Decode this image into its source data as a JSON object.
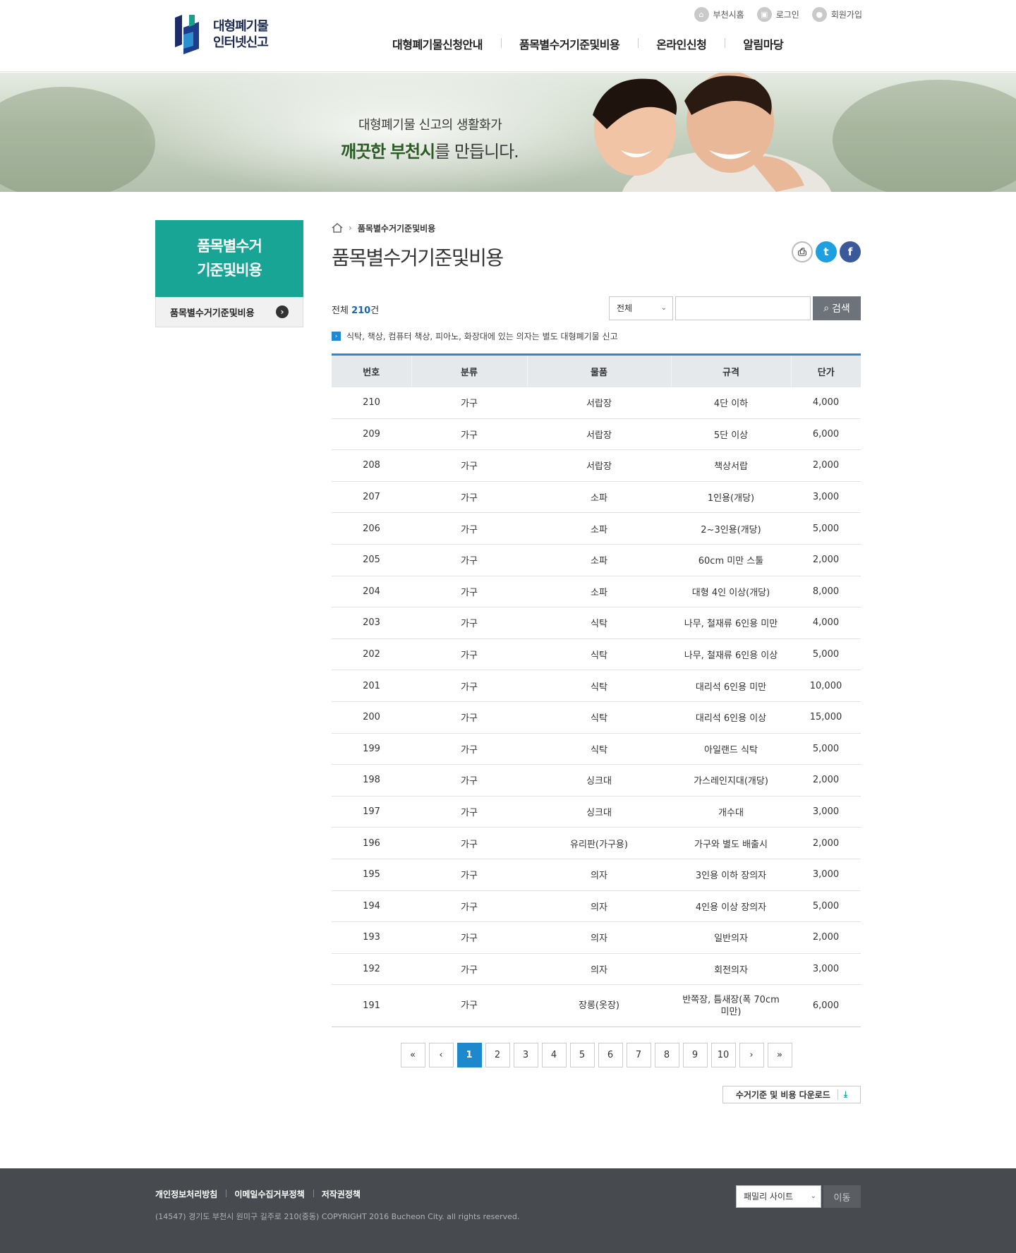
{
  "site": {
    "logo_line1": "대형폐기물",
    "logo_line2": "인터넷신고"
  },
  "util": [
    {
      "label": "부천시홈",
      "icon": "home-icon"
    },
    {
      "label": "로그인",
      "icon": "lock-icon"
    },
    {
      "label": "회원가입",
      "icon": "user-icon"
    }
  ],
  "gnb": [
    "대형폐기물신청안내",
    "품목별수거기준및비용",
    "온라인신청",
    "알림마당"
  ],
  "banner": {
    "line1": "대형폐기물 신고의 생활화가",
    "line2_bold1": "깨끗한",
    "line2_bold2": "부천시",
    "line2_rest": "를 만듭니다."
  },
  "lnb": {
    "title_line1": "품목별수거",
    "title_line2": "기준및비용",
    "item": "품목별수거기준및비용"
  },
  "breadcrumb": "품목별수거기준및비용",
  "page_title": "품목별수거기준및비용",
  "list": {
    "total_prefix": "전체",
    "total_count": "210",
    "total_suffix": "건",
    "select_value": "전체",
    "search_button": "검색",
    "notice": "식탁, 책상, 컴퓨터 책상, 피아노, 화장대에 있는 의자는 별도 대형폐기물 신고",
    "headers": [
      "번호",
      "분류",
      "물품",
      "규격",
      "단가"
    ],
    "rows": [
      [
        "210",
        "가구",
        "서랍장",
        "4단 이하",
        "4,000"
      ],
      [
        "209",
        "가구",
        "서랍장",
        "5단 이상",
        "6,000"
      ],
      [
        "208",
        "가구",
        "서랍장",
        "책상서랍",
        "2,000"
      ],
      [
        "207",
        "가구",
        "소파",
        "1인용(개당)",
        "3,000"
      ],
      [
        "206",
        "가구",
        "소파",
        "2~3인용(개당)",
        "5,000"
      ],
      [
        "205",
        "가구",
        "소파",
        "60cm 미만 스툴",
        "2,000"
      ],
      [
        "204",
        "가구",
        "소파",
        "대형 4인 이상(개당)",
        "8,000"
      ],
      [
        "203",
        "가구",
        "식탁",
        "나무, 철재류 6인용 미만",
        "4,000"
      ],
      [
        "202",
        "가구",
        "식탁",
        "나무, 철재류 6인용 이상",
        "5,000"
      ],
      [
        "201",
        "가구",
        "식탁",
        "대리석 6인용 미만",
        "10,000"
      ],
      [
        "200",
        "가구",
        "식탁",
        "대리석 6인용 이상",
        "15,000"
      ],
      [
        "199",
        "가구",
        "식탁",
        "아일랜드 식탁",
        "5,000"
      ],
      [
        "198",
        "가구",
        "싱크대",
        "가스레인지대(개당)",
        "2,000"
      ],
      [
        "197",
        "가구",
        "싱크대",
        "개수대",
        "3,000"
      ],
      [
        "196",
        "가구",
        "유리판(가구용)",
        "가구와 별도 배출시",
        "2,000"
      ],
      [
        "195",
        "가구",
        "의자",
        "3인용 이하 장의자",
        "3,000"
      ],
      [
        "194",
        "가구",
        "의자",
        "4인용 이상 장의자",
        "5,000"
      ],
      [
        "193",
        "가구",
        "의자",
        "일반의자",
        "2,000"
      ],
      [
        "192",
        "가구",
        "의자",
        "회전의자",
        "3,000"
      ],
      [
        "191",
        "가구",
        "장롱(옷장)",
        "반쪽장, 틈새장(폭 70cm 미만)",
        "6,000"
      ]
    ]
  },
  "paging": {
    "first": "«",
    "prev": "‹",
    "pages": [
      "1",
      "2",
      "3",
      "4",
      "5",
      "6",
      "7",
      "8",
      "9",
      "10"
    ],
    "current": "1",
    "next": "›",
    "last": "»"
  },
  "download_label": "수거기준 및 비용 다운로드",
  "footer": {
    "links": [
      "개인정보처리방침",
      "이메일수집거부정책",
      "저작권정책"
    ],
    "copyright": "(14547) 경기도 부천시 원미구 길주로 210(중동) COPYRIGHT 2016 Bucheon City. all rights reserved.",
    "family_site": "패밀리 사이트",
    "go_button": "이동"
  },
  "colors": {
    "accent_teal": "#19a595",
    "accent_blue": "#1e88cd",
    "footer_bg": "#474a4e"
  }
}
